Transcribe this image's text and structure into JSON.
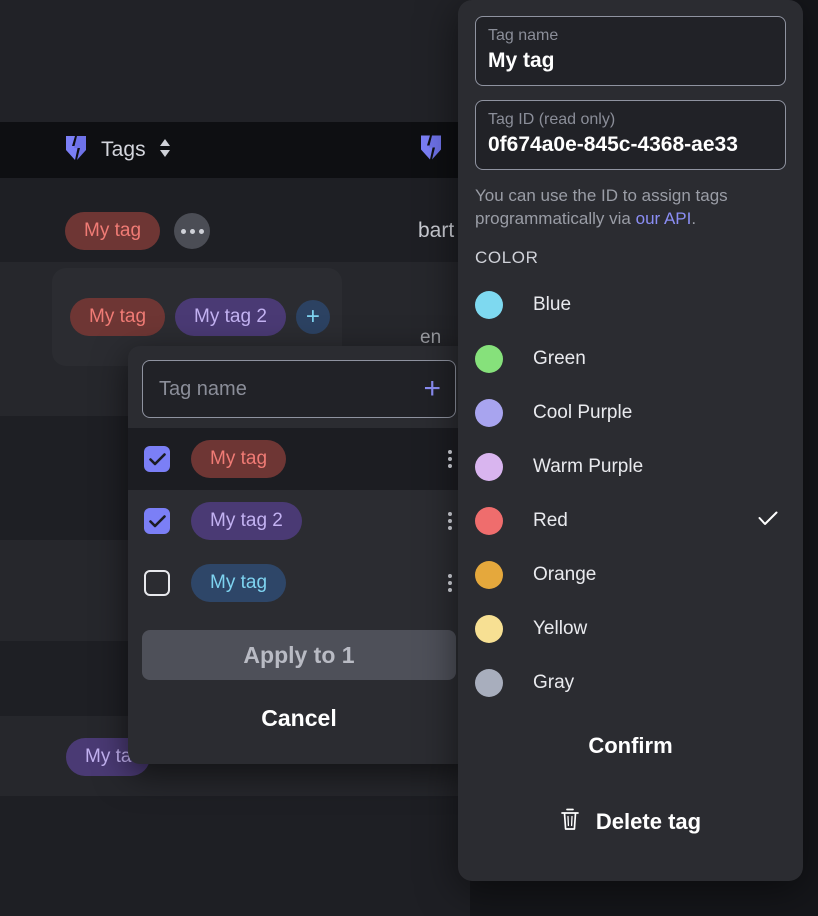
{
  "app": {
    "header": {
      "logo_icon": "shield-logo-icon",
      "title": "Tags",
      "sort_icon": "sort-updown-icon",
      "logo_icon_right": "shield-logo-icon"
    },
    "background": {
      "tag_chip": "My tag",
      "overflow_icon": "ellipsis-icon",
      "username": "bart",
      "faint_text": "en",
      "bottom_chip": "My ta"
    },
    "float_tagbar": {
      "chips": [
        {
          "label": "My tag",
          "color": "red"
        },
        {
          "label": "My tag 2",
          "color": "purple"
        }
      ],
      "add_icon": "plus-icon"
    }
  },
  "picker": {
    "input": {
      "placeholder": "Tag name",
      "value": "",
      "add_icon": "plus-icon"
    },
    "rows": [
      {
        "label": "My tag",
        "color": "red",
        "checked": true,
        "menu_icon": "kebab-menu-icon"
      },
      {
        "label": "My tag 2",
        "color": "purple",
        "checked": true,
        "menu_icon": "kebab-menu-icon"
      },
      {
        "label": "My tag",
        "color": "blue",
        "checked": false,
        "menu_icon": "kebab-menu-icon"
      }
    ],
    "apply_label": "Apply to 1",
    "cancel_label": "Cancel"
  },
  "detail": {
    "name_field": {
      "label": "Tag name",
      "value": "My tag"
    },
    "id_field": {
      "label": "Tag ID (read only)",
      "value": "0f674a0e-845c-4368-ae33"
    },
    "helper": {
      "text_before": "You can use the ID to assign tags programmatically via ",
      "link": "our API",
      "text_after": "."
    },
    "color_section_title": "COLOR",
    "colors": [
      {
        "name": "Blue",
        "hex": "#7ed9f0",
        "selected": false
      },
      {
        "name": "Green",
        "hex": "#86e17b",
        "selected": false
      },
      {
        "name": "Cool Purple",
        "hex": "#a8a4ef",
        "selected": false
      },
      {
        "name": "Warm Purple",
        "hex": "#d9b5ef",
        "selected": false
      },
      {
        "name": "Red",
        "hex": "#ef6d6d",
        "selected": true
      },
      {
        "name": "Orange",
        "hex": "#e5a83c",
        "selected": false
      },
      {
        "name": "Yellow",
        "hex": "#f7e093",
        "selected": false
      },
      {
        "name": "Gray",
        "hex": "#a8aebd",
        "selected": false
      }
    ],
    "check_icon": "check-icon",
    "confirm_label": "Confirm",
    "delete_label": "Delete tag",
    "delete_icon": "trash-icon"
  }
}
